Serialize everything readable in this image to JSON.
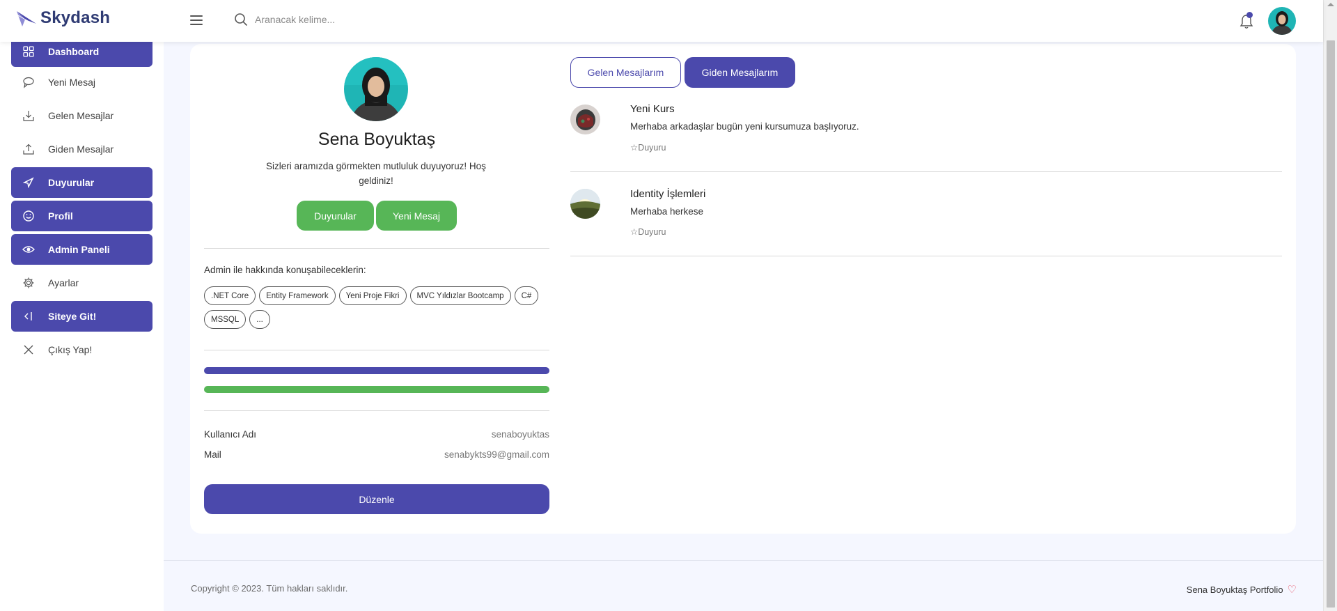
{
  "brand": {
    "name": "Skydash",
    "logo_icon": "paper-plane-wing-icon"
  },
  "search": {
    "placeholder": "Aranacak kelime..."
  },
  "sidebar": {
    "items": [
      {
        "label": "Dashboard",
        "icon": "grid-icon",
        "active": true
      },
      {
        "label": "Yeni Mesaj",
        "icon": "chat-icon",
        "active": false
      },
      {
        "label": "Gelen Mesajlar",
        "icon": "download-icon",
        "active": false
      },
      {
        "label": "Giden Mesajlar",
        "icon": "upload-icon",
        "active": false
      },
      {
        "label": "Duyurular",
        "icon": "send-icon",
        "active": true
      },
      {
        "label": "Profil",
        "icon": "smile-icon",
        "active": true
      },
      {
        "label": "Admin Paneli",
        "icon": "eye-icon",
        "active": true
      },
      {
        "label": "Ayarlar",
        "icon": "gear-icon",
        "active": false
      },
      {
        "label": "Siteye Git!",
        "icon": "exit-arrow-icon",
        "active": true
      },
      {
        "label": "Çıkış Yap!",
        "icon": "close-icon",
        "active": false
      }
    ]
  },
  "profile": {
    "name": "Sena Boyuktaş",
    "bio": "Sizleri aramızda görmekten mutluluk duyuyoruz! Hoş geldiniz!",
    "buttons": {
      "announcements": "Duyurular",
      "new_message": "Yeni Mesaj"
    },
    "topics_title": "Admin ile hakkında konuşabileceklerin:",
    "tags": [
      ".NET Core",
      "Entity Framework",
      "Yeni Proje Fikri",
      "MVC Yıldızlar Bootcamp",
      "C#",
      "MSSQL",
      "..."
    ],
    "progress": [
      {
        "value_percent": 100,
        "color": "#4b49ac"
      },
      {
        "value_percent": 100,
        "color": "#57b657"
      }
    ],
    "info": [
      {
        "key": "Kullanıcı Adı",
        "value": "senaboyuktas"
      },
      {
        "key": "Mail",
        "value": "senabykts99@gmail.com"
      }
    ],
    "edit_button": "Düzenle"
  },
  "tabs": {
    "inbox": "Gelen Mesajlarım",
    "outbox": "Giden Mesajlarım",
    "active": "outbox"
  },
  "messages": [
    {
      "title": "Yeni Kurs",
      "body": "Merhaba arkadaşlar bugün yeni kursumuza başlıyoruz.",
      "tag": "☆Duyuru"
    },
    {
      "title": "Identity İşlemleri",
      "body": "Merhaba herkese",
      "tag": "☆Duyuru"
    }
  ],
  "footer": {
    "copyright": "Copyright © 2023. Tüm hakları saklıdır.",
    "portfolio": "Sena Boyuktaş Portfolio",
    "heart_icon": "♡"
  },
  "colors": {
    "primary": "#4b49ac",
    "success": "#57b657",
    "background": "#f5f7ff"
  }
}
